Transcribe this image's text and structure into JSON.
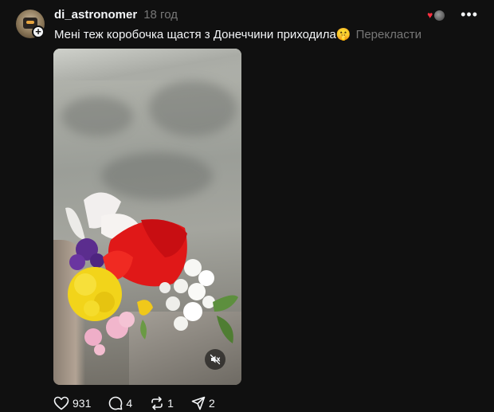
{
  "post": {
    "username": "di_astronomer",
    "timestamp": "18 год",
    "caption": "Мені теж коробочка щастя з Донеччини приходила🤫",
    "translate_label": "Перекласти",
    "media": {
      "type": "video",
      "muted": true
    },
    "actions": {
      "likes": "931",
      "comments": "4",
      "reposts": "1",
      "shares": "2"
    }
  },
  "icons": {
    "avatar_add": "plus-icon",
    "reactions": "heart-icon",
    "more": "more-icon",
    "mute": "mute-icon",
    "like": "heart-icon",
    "comment": "comment-icon",
    "repost": "repost-icon",
    "share": "send-icon"
  },
  "colors": {
    "background": "#101010",
    "text": "#f3f5f7",
    "secondary": "#777777",
    "heart": "#ff3040"
  }
}
